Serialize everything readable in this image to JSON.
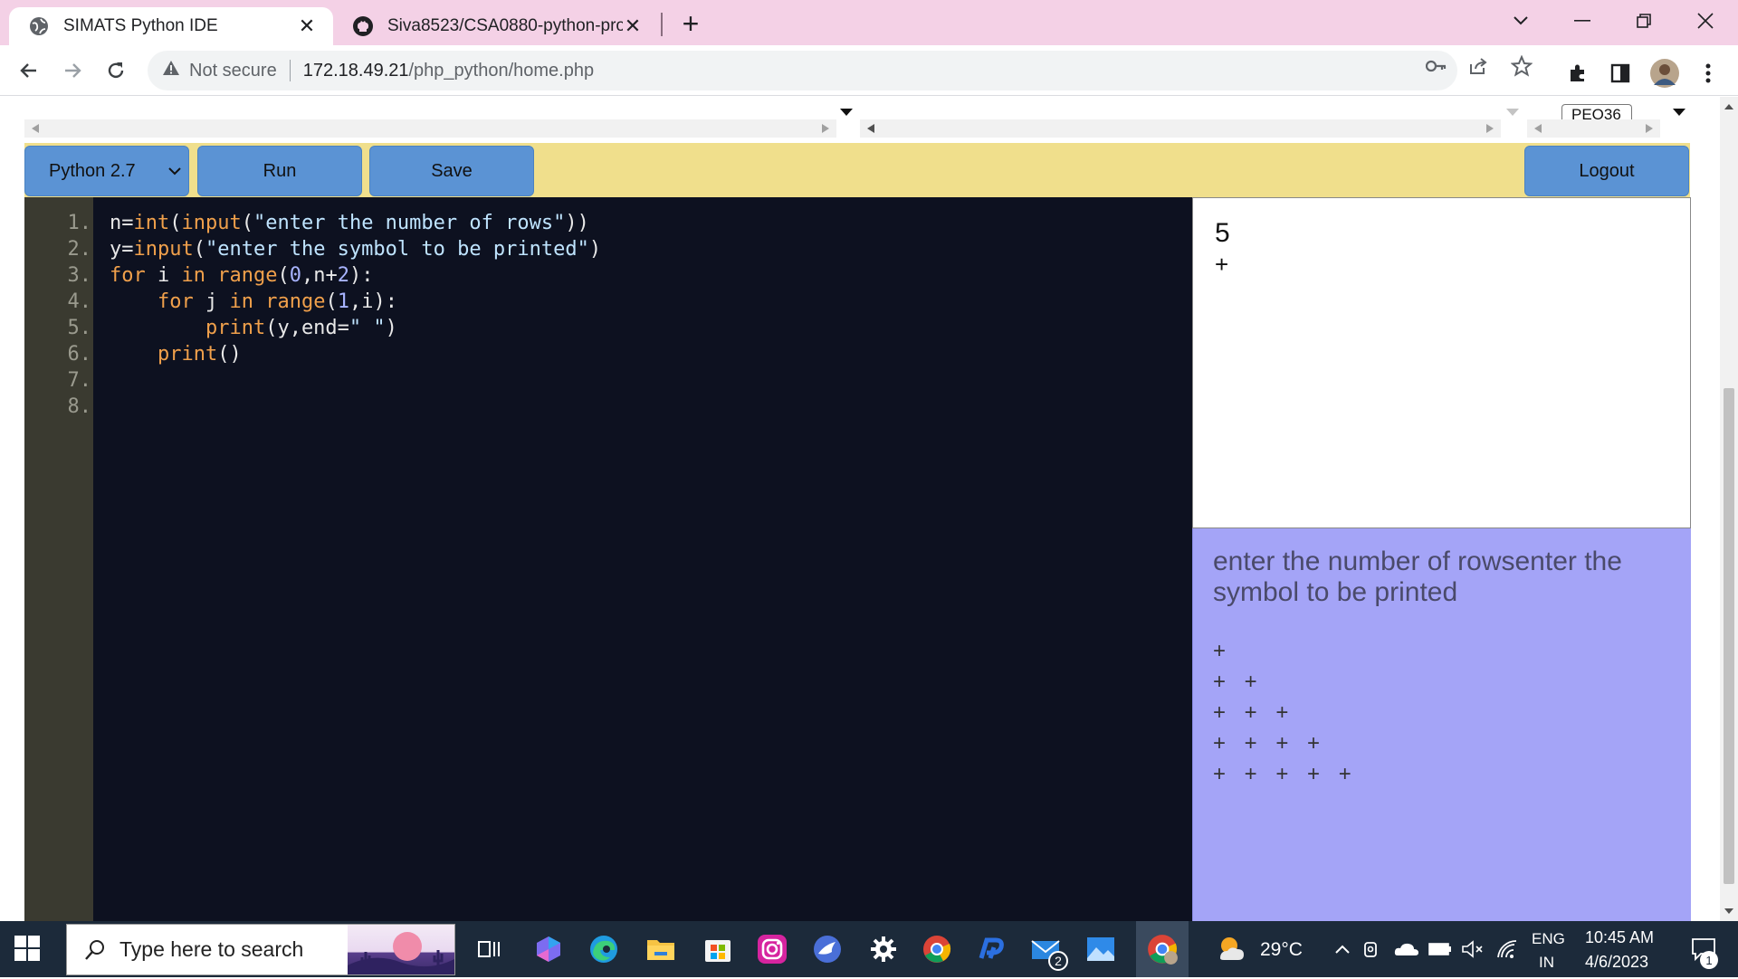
{
  "browser": {
    "tabs": [
      {
        "title": "SIMATS Python IDE",
        "active": true
      },
      {
        "title": "Siva8523/CSA0880-python-prog",
        "active": false
      }
    ],
    "address": {
      "security_label": "Not secure",
      "host": "172.18.49.21",
      "path": "/php_python/home.php"
    },
    "colors": {
      "tabbar": "#f4d1e6"
    }
  },
  "page": {
    "top_select_text": "PEO36",
    "toolbar": {
      "language": "Python 2.7",
      "run_label": "Run",
      "save_label": "Save",
      "logout_label": "Logout"
    },
    "editor": {
      "line_numbers": [
        "1.",
        "2.",
        "3.",
        "4.",
        "5.",
        "6.",
        "7.",
        "8."
      ]
    },
    "input": {
      "lines": [
        "5",
        "+"
      ]
    },
    "output": {
      "prompt": "enter the number of rowsenter the symbol to be printed",
      "lines": [
        "+",
        "+ +",
        "+ + +",
        "+ + + +",
        "+ + + + +"
      ]
    },
    "colors": {
      "toolbar_bg": "#f0df8c",
      "button_bg": "#5b93d4",
      "editor_bg": "#0d1120",
      "output_bg": "#a4a4f7"
    }
  },
  "taskbar": {
    "search_placeholder": "Type here to search",
    "weather": "29°C",
    "lang_top": "ENG",
    "lang_bottom": "IN",
    "time": "10:45 AM",
    "date": "4/6/2023",
    "mail_badge": "2",
    "notification_count": "1"
  }
}
